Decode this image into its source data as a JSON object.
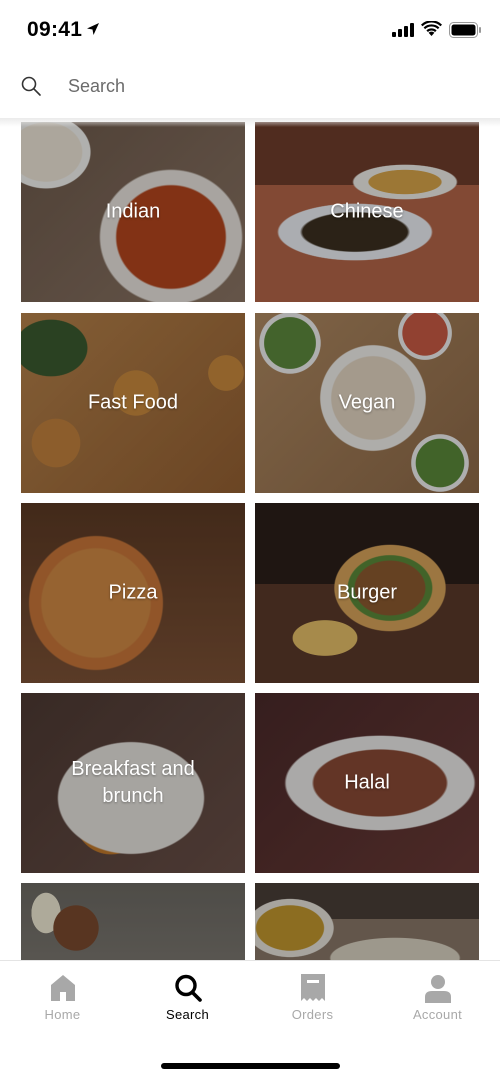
{
  "status_bar": {
    "time": "09:41"
  },
  "search": {
    "placeholder": "Search",
    "value": ""
  },
  "categories": [
    {
      "label": "Indian"
    },
    {
      "label": "Chinese"
    },
    {
      "label": "Fast Food"
    },
    {
      "label": "Vegan"
    },
    {
      "label": "Pizza"
    },
    {
      "label": "Burger"
    },
    {
      "label": "Breakfast and brunch"
    },
    {
      "label": "Halal"
    },
    {
      "label": ""
    },
    {
      "label": ""
    }
  ],
  "tab_bar": {
    "active": "Search",
    "tabs": [
      {
        "label": "Home",
        "icon": "home-icon"
      },
      {
        "label": "Search",
        "icon": "search-icon"
      },
      {
        "label": "Orders",
        "icon": "receipt-icon"
      },
      {
        "label": "Account",
        "icon": "person-icon"
      }
    ]
  },
  "colors": {
    "active_tab": "#000000",
    "inactive_tab": "#a8a8a8"
  }
}
